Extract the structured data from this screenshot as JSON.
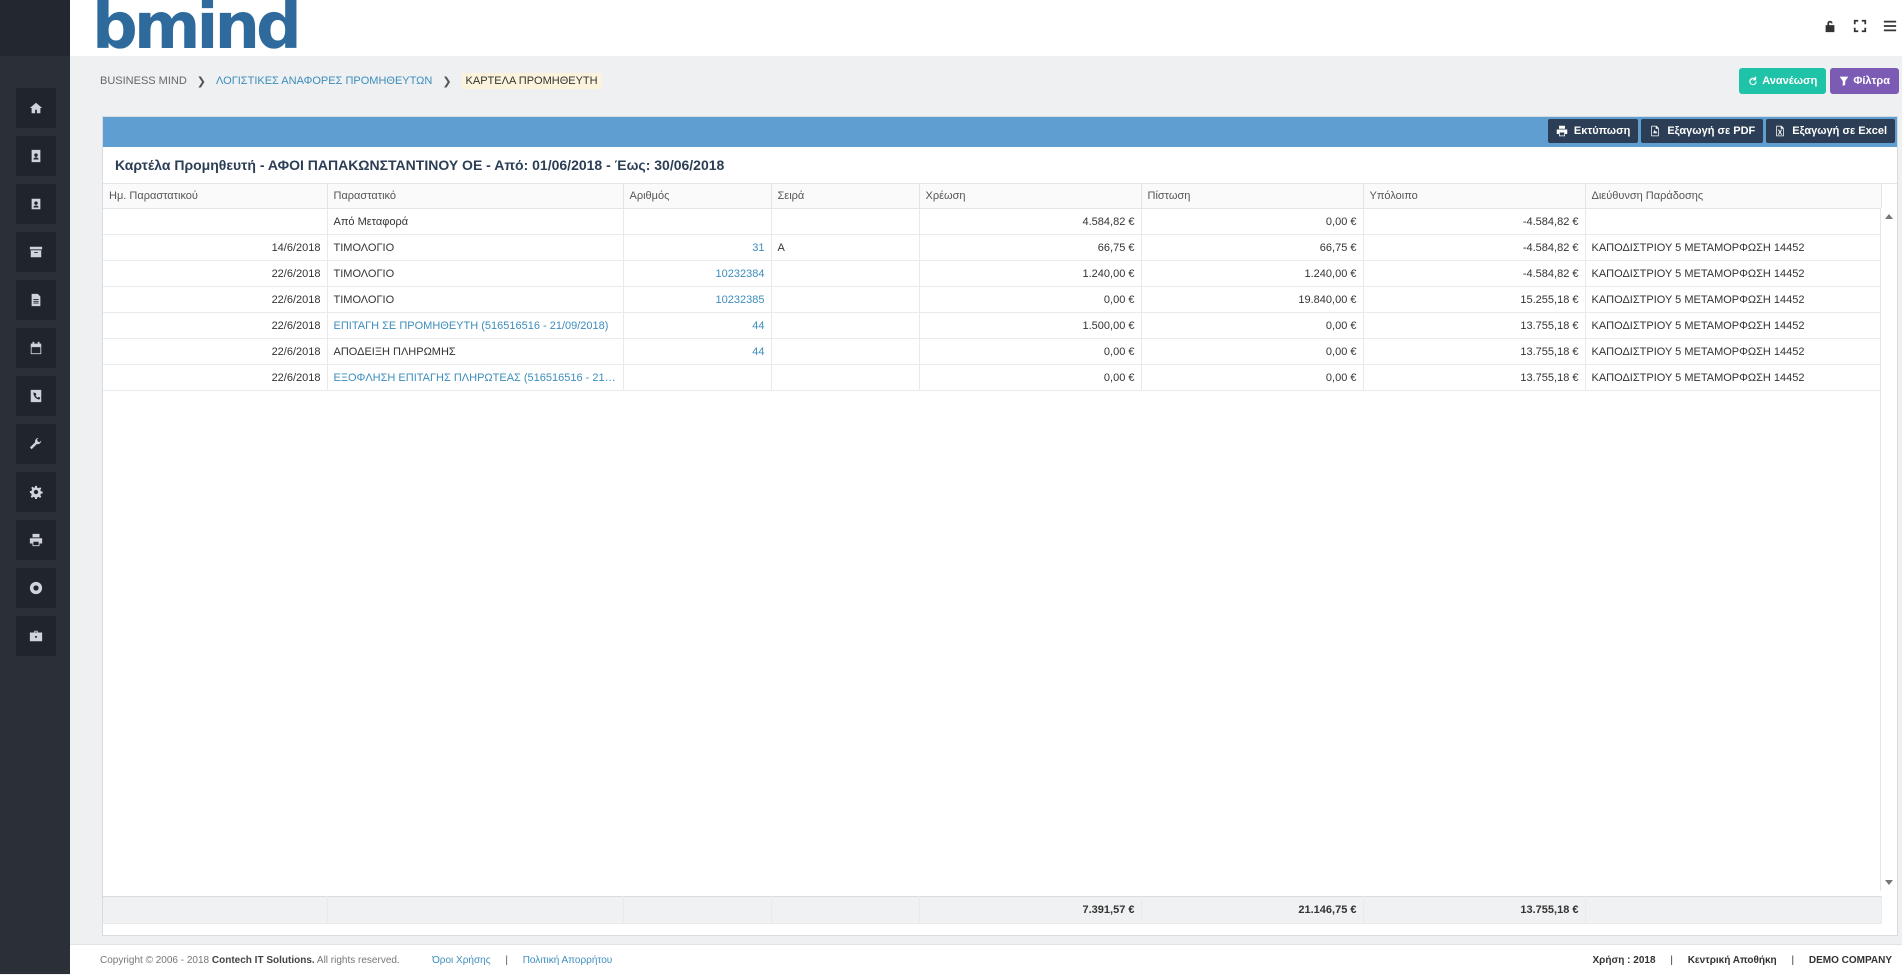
{
  "brand": {
    "logo_text": "bmind"
  },
  "breadcrumb": {
    "items": [
      "BUSINESS MIND",
      "ΛΟΓΙΣΤΙΚΕΣ ΑΝΑΦΟΡΕΣ ΠΡΟΜΗΘΕΥΤΩΝ",
      "ΚΑΡΤΕΛΑ ΠΡΟΜΗΘΕΥΤΗ"
    ]
  },
  "actions": {
    "refresh_label": "Ανανέωση",
    "filter_label": "Φίλτρα"
  },
  "exports": {
    "print_label": "Εκτύπωση",
    "pdf_label": "Εξαγωγή σε PDF",
    "excel_label": "Εξαγωγή σε Excel"
  },
  "report": {
    "title": "Καρτέλα Προμηθευτή - ΑΦΟΙ ΠΑΠΑΚΩΝΣΤΑΝΤΙΝΟΥ ΟΕ - Από: 01/06/2018 - Έως: 30/06/2018",
    "columns": [
      "Ημ. Παραστατικού",
      "Παραστατικό",
      "Αριθμός",
      "Σειρά",
      "Χρέωση",
      "Πίστωση",
      "Υπόλοιπο",
      "Διεύθυνση Παράδοσης"
    ],
    "rows": [
      {
        "date": "",
        "doc": "Από Μεταφορά",
        "num": "",
        "series": "",
        "debit": "4.584,82 €",
        "credit": "0,00 €",
        "balance": "-4.584,82 €",
        "address": ""
      },
      {
        "date": "14/6/2018",
        "doc": "ΤΙΜΟΛΟΓΙΟ",
        "num": "31",
        "series": "Α",
        "debit": "66,75 €",
        "credit": "66,75 €",
        "balance": "-4.584,82 €",
        "address": "ΚΑΠΟΔΙΣΤΡΙΟΥ 5 ΜΕΤΑΜΟΡΦΩΣΗ 14452"
      },
      {
        "date": "22/6/2018",
        "doc": "ΤΙΜΟΛΟΓΙΟ",
        "num": "10232384",
        "series": "",
        "debit": "1.240,00 €",
        "credit": "1.240,00 €",
        "balance": "-4.584,82 €",
        "address": "ΚΑΠΟΔΙΣΤΡΙΟΥ 5 ΜΕΤΑΜΟΡΦΩΣΗ 14452"
      },
      {
        "date": "22/6/2018",
        "doc": "ΤΙΜΟΛΟΓΙΟ",
        "num": "10232385",
        "series": "",
        "debit": "0,00 €",
        "credit": "19.840,00 €",
        "balance": "15.255,18 €",
        "address": "ΚΑΠΟΔΙΣΤΡΙΟΥ 5 ΜΕΤΑΜΟΡΦΩΣΗ 14452"
      },
      {
        "date": "22/6/2018",
        "doc": "ΕΠΙΤΑΓΗ ΣΕ ΠΡΟΜΗΘΕΥΤΗ (516516516 - 21/09/2018)",
        "num": "44",
        "series": "",
        "debit": "1.500,00 €",
        "credit": "0,00 €",
        "balance": "13.755,18 €",
        "address": "ΚΑΠΟΔΙΣΤΡΙΟΥ 5 ΜΕΤΑΜΟΡΦΩΣΗ 14452"
      },
      {
        "date": "22/6/2018",
        "doc": "ΑΠΟΔΕΙΞΗ ΠΛΗΡΩΜΗΣ",
        "num": "44",
        "series": "",
        "debit": "0,00 €",
        "credit": "0,00 €",
        "balance": "13.755,18 €",
        "address": "ΚΑΠΟΔΙΣΤΡΙΟΥ 5 ΜΕΤΑΜΟΡΦΩΣΗ 14452"
      },
      {
        "date": "22/6/2018",
        "doc": "ΕΞΟΦΛΗΣΗ ΕΠΙΤΑΓΗΣ ΠΛΗΡΩΤΕΑΣ (516516516 - 21/0...",
        "num": "",
        "series": "",
        "debit": "0,00 €",
        "credit": "0,00 €",
        "balance": "13.755,18 €",
        "address": "ΚΑΠΟΔΙΣΤΡΙΟΥ 5 ΜΕΤΑΜΟΡΦΩΣΗ 14452"
      }
    ],
    "totals": {
      "debit": "7.391,57 €",
      "credit": "21.146,75 €",
      "balance": "13.755,18 €"
    }
  },
  "footer": {
    "copyright_prefix": "Copyright © 2006 - 2018",
    "company": "Contech IT Solutions.",
    "rights": "All rights reserved.",
    "terms": "Όροι Χρήσης",
    "privacy": "Πολιτική Απορρήτου",
    "year_label": "Χρήση : 2018",
    "warehouse": "Κεντρική Αποθήκη",
    "company_name": "DEMO COMPANY"
  },
  "icons": {
    "sidebar": [
      "home-icon",
      "contact-book-icon",
      "address-card-icon",
      "archive-icon",
      "document-icon",
      "calendar-icon",
      "phone-book-icon",
      "wrench-icon",
      "gear-icon",
      "printer-icon",
      "lifebuoy-icon",
      "briefcase-icon"
    ],
    "top": [
      "lock-icon",
      "fullscreen-icon",
      "menu-icon"
    ]
  }
}
